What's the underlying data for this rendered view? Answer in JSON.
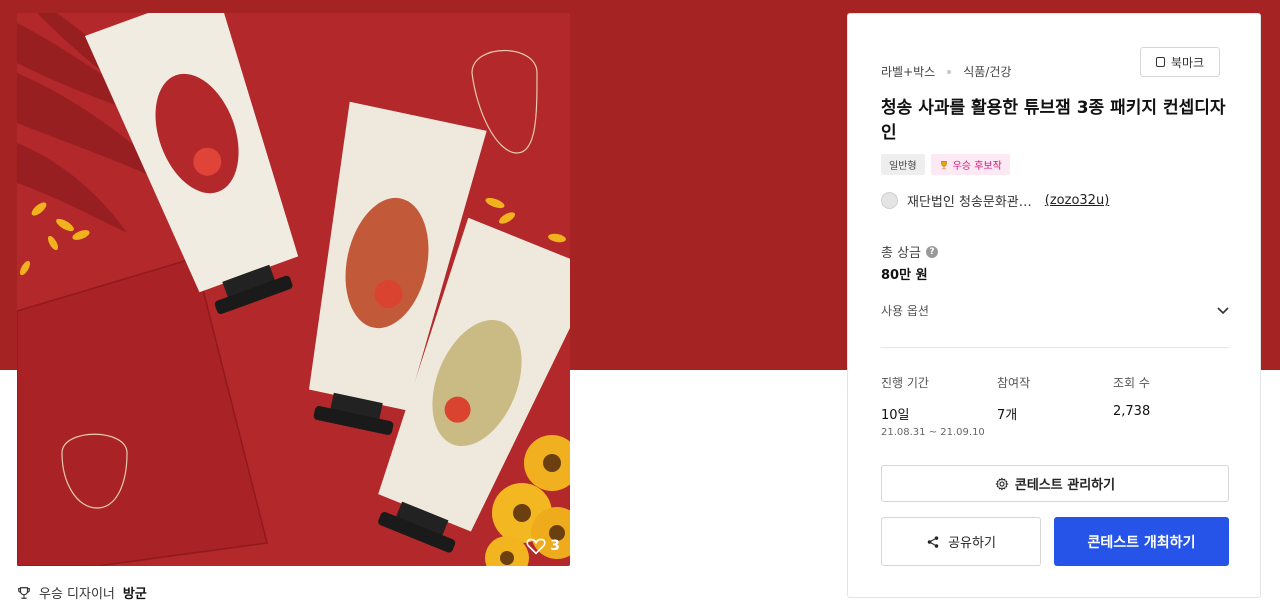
{
  "product": {
    "like_count": "3"
  },
  "designer": {
    "prefix": "우승 디자이너",
    "name": "방군"
  },
  "card": {
    "category_primary": "라벨+박스",
    "category_secondary": "식품/건강",
    "bookmark_label": "북마크",
    "title": "청송 사과를 활용한 튜브잼 3종 패키지 컨셉디자인",
    "tag_type": "일반형",
    "tag_award": "우승 후보작",
    "host_name": "재단법인 청송문화관…",
    "host_id": "(zozo32u)",
    "prize_label": "총 상금",
    "prize_value": "80만 원",
    "options_label": "사용 옵션",
    "stats": {
      "period_label": "진행 기간",
      "period_value": "10일",
      "period_range": "21.08.31 ~ 21.09.10",
      "entries_label": "참여작",
      "entries_value": "7개",
      "views_label": "조회 수",
      "views_value": "2,738"
    },
    "manage_button": "콘테스트 관리하기",
    "share_button": "공유하기",
    "host_button": "콘테스트 개최하기"
  },
  "colors": {
    "hero_red": "#a52323",
    "primary_blue": "#2654e8",
    "award_pink": "#d3187a"
  },
  "icons": [
    "heart-icon",
    "trophy-icon",
    "bookmark-icon",
    "help-icon",
    "chevron-down-icon",
    "gear-icon",
    "share-icon"
  ]
}
